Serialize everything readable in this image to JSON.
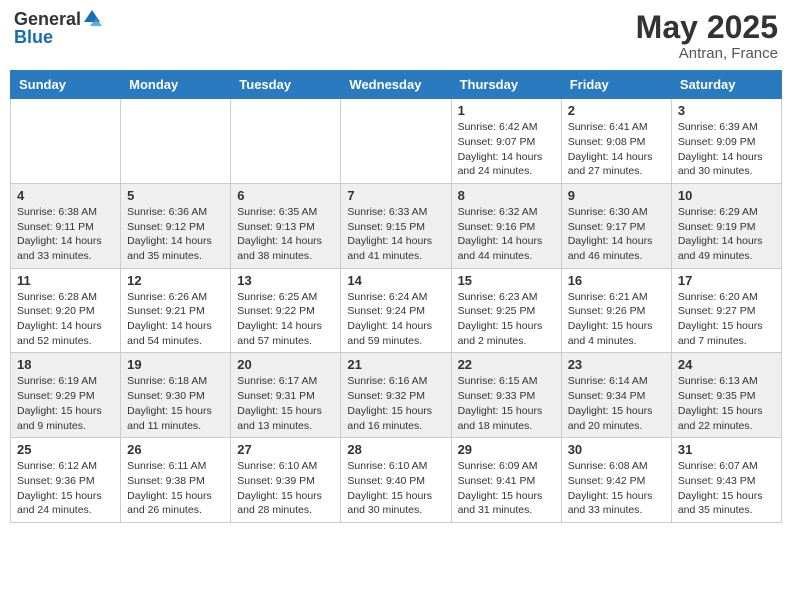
{
  "header": {
    "logo_general": "General",
    "logo_blue": "Blue",
    "month_year": "May 2025",
    "location": "Antran, France"
  },
  "weekdays": [
    "Sunday",
    "Monday",
    "Tuesday",
    "Wednesday",
    "Thursday",
    "Friday",
    "Saturday"
  ],
  "weeks": [
    [
      {
        "day": "",
        "info": ""
      },
      {
        "day": "",
        "info": ""
      },
      {
        "day": "",
        "info": ""
      },
      {
        "day": "",
        "info": ""
      },
      {
        "day": "1",
        "info": "Sunrise: 6:42 AM\nSunset: 9:07 PM\nDaylight: 14 hours\nand 24 minutes."
      },
      {
        "day": "2",
        "info": "Sunrise: 6:41 AM\nSunset: 9:08 PM\nDaylight: 14 hours\nand 27 minutes."
      },
      {
        "day": "3",
        "info": "Sunrise: 6:39 AM\nSunset: 9:09 PM\nDaylight: 14 hours\nand 30 minutes."
      }
    ],
    [
      {
        "day": "4",
        "info": "Sunrise: 6:38 AM\nSunset: 9:11 PM\nDaylight: 14 hours\nand 33 minutes."
      },
      {
        "day": "5",
        "info": "Sunrise: 6:36 AM\nSunset: 9:12 PM\nDaylight: 14 hours\nand 35 minutes."
      },
      {
        "day": "6",
        "info": "Sunrise: 6:35 AM\nSunset: 9:13 PM\nDaylight: 14 hours\nand 38 minutes."
      },
      {
        "day": "7",
        "info": "Sunrise: 6:33 AM\nSunset: 9:15 PM\nDaylight: 14 hours\nand 41 minutes."
      },
      {
        "day": "8",
        "info": "Sunrise: 6:32 AM\nSunset: 9:16 PM\nDaylight: 14 hours\nand 44 minutes."
      },
      {
        "day": "9",
        "info": "Sunrise: 6:30 AM\nSunset: 9:17 PM\nDaylight: 14 hours\nand 46 minutes."
      },
      {
        "day": "10",
        "info": "Sunrise: 6:29 AM\nSunset: 9:19 PM\nDaylight: 14 hours\nand 49 minutes."
      }
    ],
    [
      {
        "day": "11",
        "info": "Sunrise: 6:28 AM\nSunset: 9:20 PM\nDaylight: 14 hours\nand 52 minutes."
      },
      {
        "day": "12",
        "info": "Sunrise: 6:26 AM\nSunset: 9:21 PM\nDaylight: 14 hours\nand 54 minutes."
      },
      {
        "day": "13",
        "info": "Sunrise: 6:25 AM\nSunset: 9:22 PM\nDaylight: 14 hours\nand 57 minutes."
      },
      {
        "day": "14",
        "info": "Sunrise: 6:24 AM\nSunset: 9:24 PM\nDaylight: 14 hours\nand 59 minutes."
      },
      {
        "day": "15",
        "info": "Sunrise: 6:23 AM\nSunset: 9:25 PM\nDaylight: 15 hours\nand 2 minutes."
      },
      {
        "day": "16",
        "info": "Sunrise: 6:21 AM\nSunset: 9:26 PM\nDaylight: 15 hours\nand 4 minutes."
      },
      {
        "day": "17",
        "info": "Sunrise: 6:20 AM\nSunset: 9:27 PM\nDaylight: 15 hours\nand 7 minutes."
      }
    ],
    [
      {
        "day": "18",
        "info": "Sunrise: 6:19 AM\nSunset: 9:29 PM\nDaylight: 15 hours\nand 9 minutes."
      },
      {
        "day": "19",
        "info": "Sunrise: 6:18 AM\nSunset: 9:30 PM\nDaylight: 15 hours\nand 11 minutes."
      },
      {
        "day": "20",
        "info": "Sunrise: 6:17 AM\nSunset: 9:31 PM\nDaylight: 15 hours\nand 13 minutes."
      },
      {
        "day": "21",
        "info": "Sunrise: 6:16 AM\nSunset: 9:32 PM\nDaylight: 15 hours\nand 16 minutes."
      },
      {
        "day": "22",
        "info": "Sunrise: 6:15 AM\nSunset: 9:33 PM\nDaylight: 15 hours\nand 18 minutes."
      },
      {
        "day": "23",
        "info": "Sunrise: 6:14 AM\nSunset: 9:34 PM\nDaylight: 15 hours\nand 20 minutes."
      },
      {
        "day": "24",
        "info": "Sunrise: 6:13 AM\nSunset: 9:35 PM\nDaylight: 15 hours\nand 22 minutes."
      }
    ],
    [
      {
        "day": "25",
        "info": "Sunrise: 6:12 AM\nSunset: 9:36 PM\nDaylight: 15 hours\nand 24 minutes."
      },
      {
        "day": "26",
        "info": "Sunrise: 6:11 AM\nSunset: 9:38 PM\nDaylight: 15 hours\nand 26 minutes."
      },
      {
        "day": "27",
        "info": "Sunrise: 6:10 AM\nSunset: 9:39 PM\nDaylight: 15 hours\nand 28 minutes."
      },
      {
        "day": "28",
        "info": "Sunrise: 6:10 AM\nSunset: 9:40 PM\nDaylight: 15 hours\nand 30 minutes."
      },
      {
        "day": "29",
        "info": "Sunrise: 6:09 AM\nSunset: 9:41 PM\nDaylight: 15 hours\nand 31 minutes."
      },
      {
        "day": "30",
        "info": "Sunrise: 6:08 AM\nSunset: 9:42 PM\nDaylight: 15 hours\nand 33 minutes."
      },
      {
        "day": "31",
        "info": "Sunrise: 6:07 AM\nSunset: 9:43 PM\nDaylight: 15 hours\nand 35 minutes."
      }
    ]
  ]
}
